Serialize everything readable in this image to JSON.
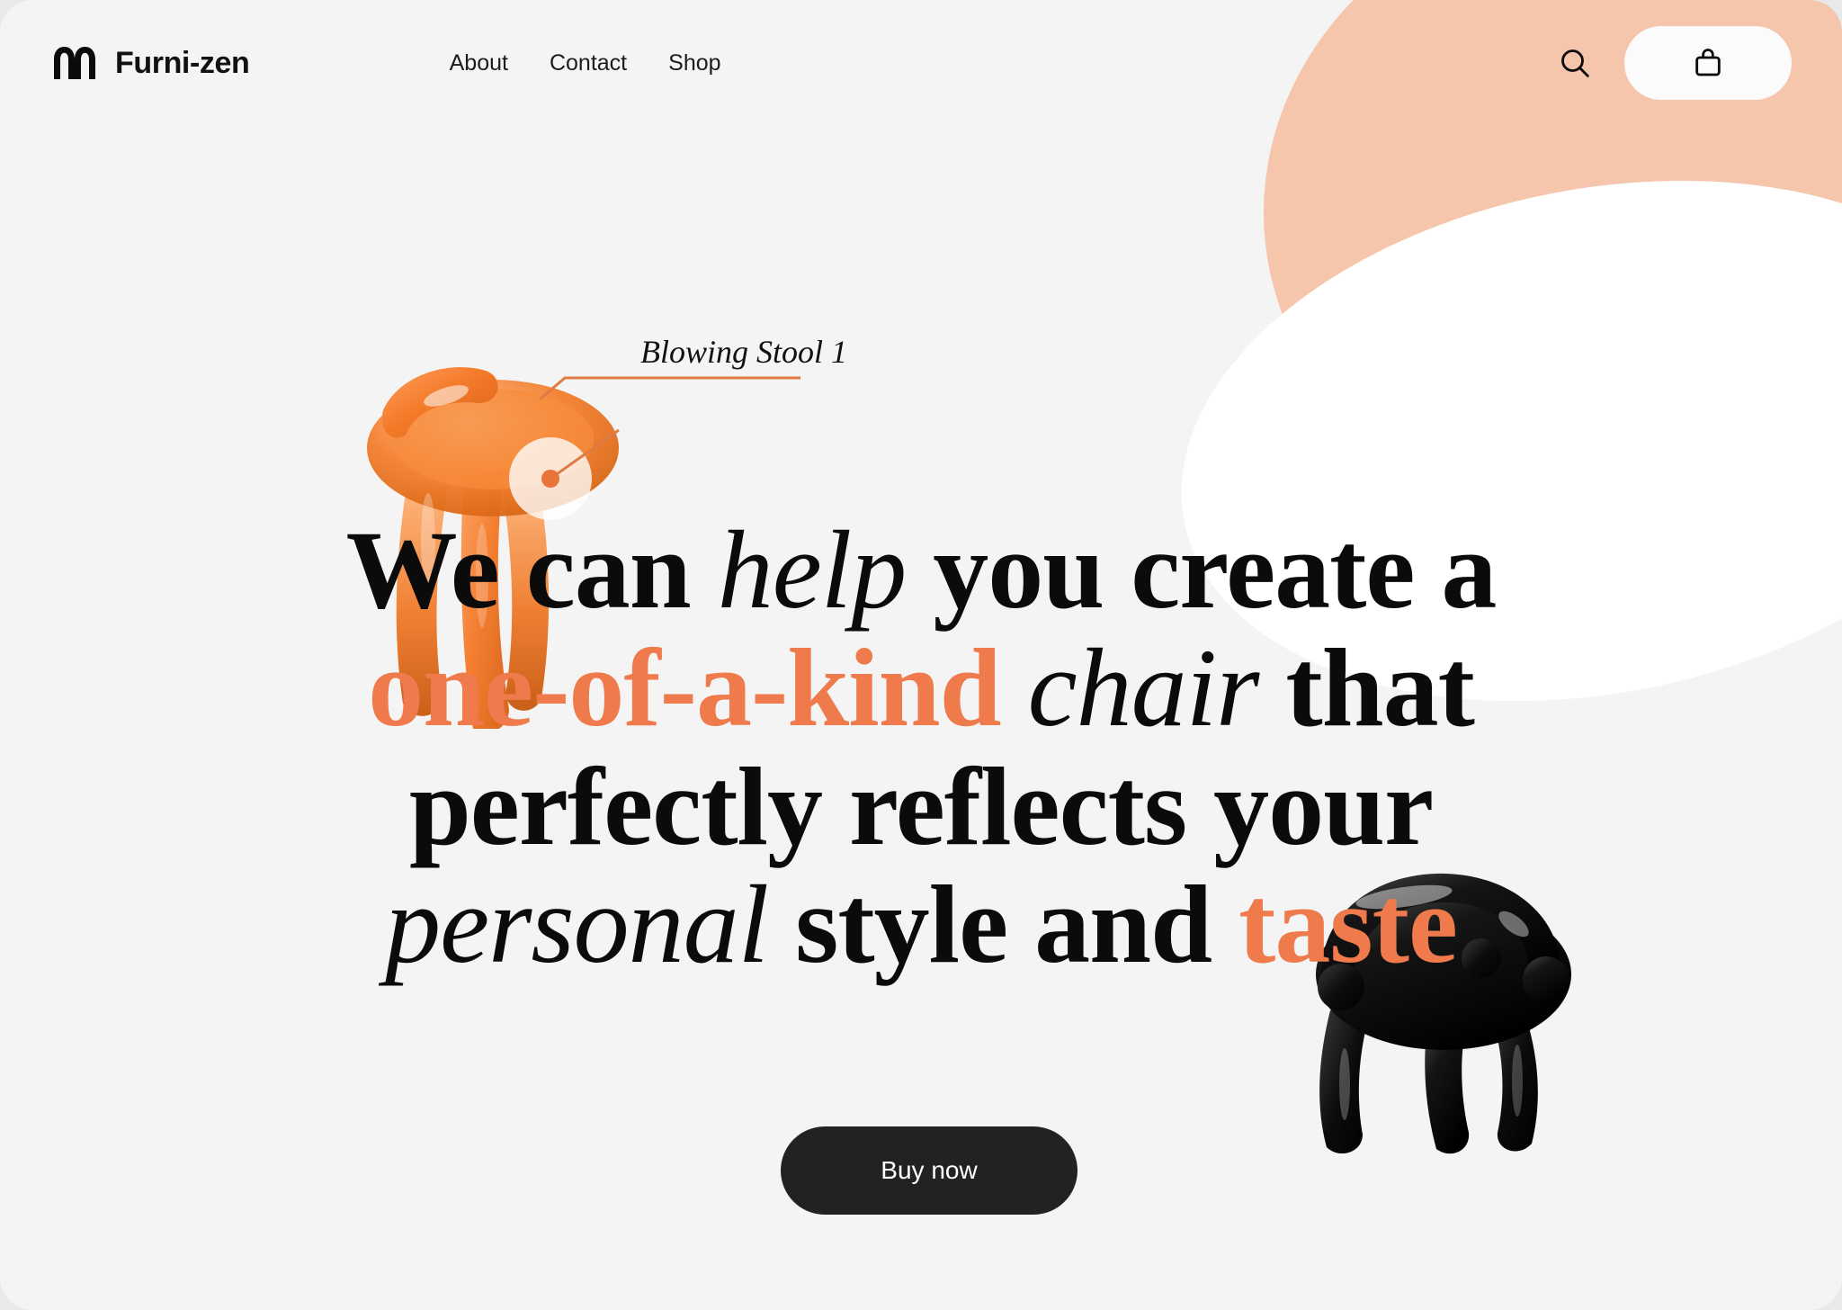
{
  "brand": {
    "name": "Furni-zen",
    "logo_icon": "double-arch-logo-icon"
  },
  "nav": {
    "items": [
      {
        "label": "About"
      },
      {
        "label": "Contact"
      },
      {
        "label": "Shop"
      }
    ]
  },
  "header_actions": {
    "search_icon": "search-icon",
    "cart_icon": "shopping-bag-icon"
  },
  "callout": {
    "label": "Blowing Stool 1",
    "line_color": "#e07a45"
  },
  "headline": {
    "line1_a": "We can ",
    "line1_b": "help",
    "line1_c": " you create a",
    "line2_a": "one-of-a-kind",
    "line2_b": " chair",
    "line2_c": " that",
    "line3": "perfectly reflects your",
    "line4_a": "personal",
    "line4_b": " style and ",
    "line4_c": "taste"
  },
  "cta": {
    "buy_now_label": "Buy now"
  },
  "products": {
    "orange_stool": "orange-blowing-stool",
    "black_stool": "black-blowing-stool"
  },
  "colors": {
    "accent_orange": "#ef7a4c",
    "peach_blob": "#f5c6ab",
    "white_blob": "#ffffff",
    "page_background": "#f4f4f4",
    "cta_background": "#222222",
    "text_primary": "#0b0b0b"
  }
}
